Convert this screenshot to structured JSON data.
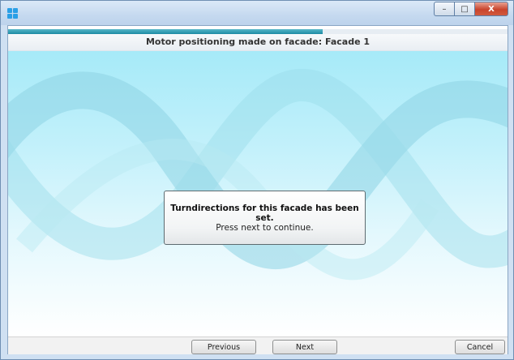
{
  "window": {
    "controls": {
      "minimize": "–",
      "maximize": "□",
      "close": "X"
    }
  },
  "wizard": {
    "progress_fraction": 0.63,
    "title": "Motor positioning made on facade: Facade 1"
  },
  "dialog": {
    "title": "Turndirections for this facade has been set.",
    "message": "Press next to continue."
  },
  "footer": {
    "previous_label": "Previous",
    "next_label": "Next",
    "cancel_label": "Cancel"
  },
  "colors": {
    "progress": "#1c8aa4",
    "content_background": "#a6eaf8",
    "ribbon": "#8ed3e3"
  },
  "icons": {
    "app": "app-grid-icon"
  }
}
